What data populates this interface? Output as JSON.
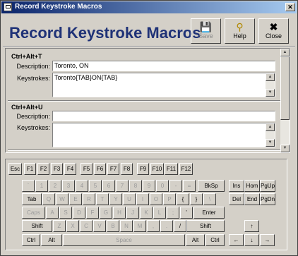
{
  "window": {
    "title": "Record Keystroke Macros",
    "close_glyph": "✕"
  },
  "header": {
    "title": "Record Keystroke Macros"
  },
  "toolbar": {
    "save": {
      "label": "Save",
      "icon": "floppy-icon",
      "enabled": false
    },
    "help": {
      "label": "Help",
      "icon": "lightbulb-icon"
    },
    "close": {
      "label": "Close",
      "icon": "close-icon"
    }
  },
  "macros": [
    {
      "shortcut": "Ctrl+Alt+T",
      "description_label": "Description:",
      "description": "Toronto, ON",
      "keystrokes_label": "Keystrokes:",
      "keystrokes": "Toronto{TAB}ON{TAB}"
    },
    {
      "shortcut": "Ctrl+Alt+U",
      "description_label": "Description:",
      "description": "",
      "keystrokes_label": "Keystrokes:",
      "keystrokes": ""
    }
  ],
  "glyphs": {
    "up": "▲",
    "down": "▼"
  },
  "keyboard": {
    "fn_row": [
      "Esc",
      "F1",
      "F2",
      "F3",
      "F4",
      "F5",
      "F6",
      "F7",
      "F8",
      "F9",
      "F10",
      "F11",
      "F12"
    ],
    "row1": [
      "`",
      "1",
      "2",
      "3",
      "4",
      "5",
      "6",
      "7",
      "8",
      "9",
      "0",
      "-",
      "=",
      "BkSp"
    ],
    "row2": [
      "Tab",
      "Q",
      "W",
      "E",
      "R",
      "T",
      "Y",
      "U",
      "I",
      "O",
      "P",
      "{",
      "}",
      "\\"
    ],
    "row3": [
      "Caps",
      "A",
      "S",
      "D",
      "F",
      "G",
      "H",
      "J",
      "K",
      "L",
      ";",
      "'",
      "Enter"
    ],
    "row4": [
      "Shift",
      "Z",
      "X",
      "C",
      "V",
      "B",
      "N",
      "M",
      ",",
      ".",
      "/",
      "Shift"
    ],
    "row5": [
      "Ctrl",
      "Alt",
      "Space",
      "Alt",
      "Ctrl"
    ],
    "nav1": [
      "Ins",
      "Hom",
      "PgUp"
    ],
    "nav2": [
      "Del",
      "End",
      "PgDn"
    ],
    "arrows": {
      "up": "↑",
      "left": "←",
      "down": "↓",
      "right": "→"
    }
  }
}
